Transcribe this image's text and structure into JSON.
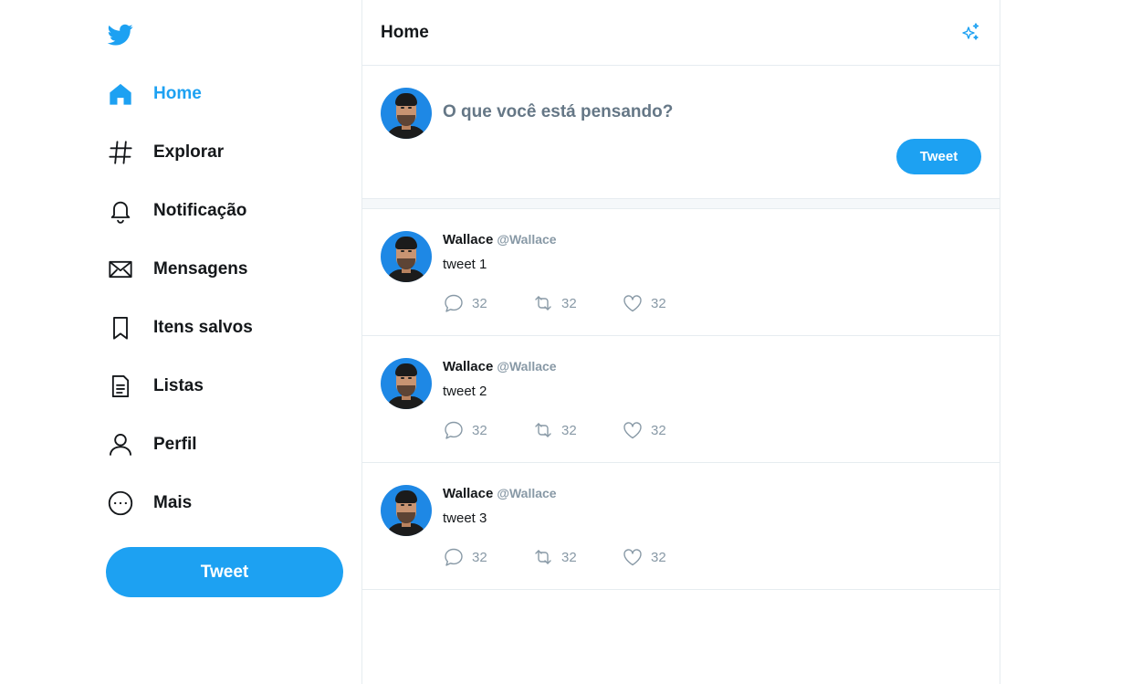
{
  "colors": {
    "accent": "#1da1f2",
    "text": "#14171a",
    "muted": "#8899a6",
    "border": "#e6ecf0"
  },
  "sidebar": {
    "logo_icon": "twitter-bird-icon",
    "items": [
      {
        "label": "Home",
        "icon": "home-icon",
        "active": true
      },
      {
        "label": "Explorar",
        "icon": "hashtag-icon"
      },
      {
        "label": "Notificação",
        "icon": "bell-icon"
      },
      {
        "label": "Mensagens",
        "icon": "envelope-icon"
      },
      {
        "label": "Itens salvos",
        "icon": "bookmark-icon"
      },
      {
        "label": "Listas",
        "icon": "list-document-icon"
      },
      {
        "label": "Perfil",
        "icon": "user-icon"
      },
      {
        "label": "Mais",
        "icon": "more-circle-icon"
      }
    ],
    "tweet_button": "Tweet"
  },
  "header": {
    "title": "Home",
    "icon": "sparkle-icon"
  },
  "composer": {
    "placeholder": "O que você está pensando?",
    "button": "Tweet"
  },
  "tweets": [
    {
      "name": "Wallace",
      "handle": "@Wallace",
      "text": "tweet 1",
      "replies": "32",
      "retweets": "32",
      "likes": "32"
    },
    {
      "name": "Wallace",
      "handle": "@Wallace",
      "text": "tweet 2",
      "replies": "32",
      "retweets": "32",
      "likes": "32"
    },
    {
      "name": "Wallace",
      "handle": "@Wallace",
      "text": "tweet 3",
      "replies": "32",
      "retweets": "32",
      "likes": "32"
    }
  ]
}
